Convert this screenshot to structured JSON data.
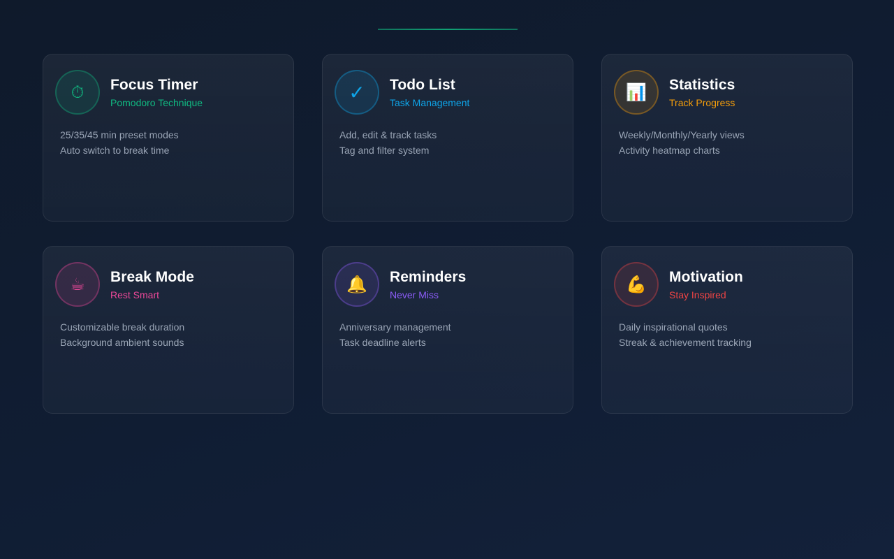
{
  "cards": [
    {
      "title": "Focus Timer",
      "subtitle": "Pomodoro Technique",
      "icon": "⏱",
      "icon_name": "stopwatch-icon",
      "accent": "#10b981",
      "lines": [
        "25/35/45 min preset modes",
        "Auto switch to break time"
      ]
    },
    {
      "title": "Todo List",
      "subtitle": "Task Management",
      "icon": "✓",
      "icon_name": "checkmark-icon",
      "accent": "#0ea5e9",
      "lines": [
        "Add, edit & track tasks",
        "Tag and filter system"
      ]
    },
    {
      "title": "Statistics",
      "subtitle": "Track Progress",
      "icon": "📊",
      "icon_name": "bar-chart-icon",
      "accent": "#f59e0b",
      "lines": [
        "Weekly/Monthly/Yearly views",
        "Activity heatmap charts"
      ]
    },
    {
      "title": "Break Mode",
      "subtitle": "Rest Smart",
      "icon": "☕",
      "icon_name": "coffee-icon",
      "accent": "#ec4899",
      "lines": [
        "Customizable break duration",
        "Background ambient sounds"
      ]
    },
    {
      "title": "Reminders",
      "subtitle": "Never Miss",
      "icon": "🔔",
      "icon_name": "bell-icon",
      "accent": "#8b5cf6",
      "lines": [
        "Anniversary management",
        "Task deadline alerts"
      ]
    },
    {
      "title": "Motivation",
      "subtitle": "Stay Inspired",
      "icon": "💪",
      "icon_name": "flexed-biceps-icon",
      "accent": "#ef4444",
      "lines": [
        "Daily inspirational quotes",
        "Streak & achievement tracking"
      ]
    }
  ]
}
